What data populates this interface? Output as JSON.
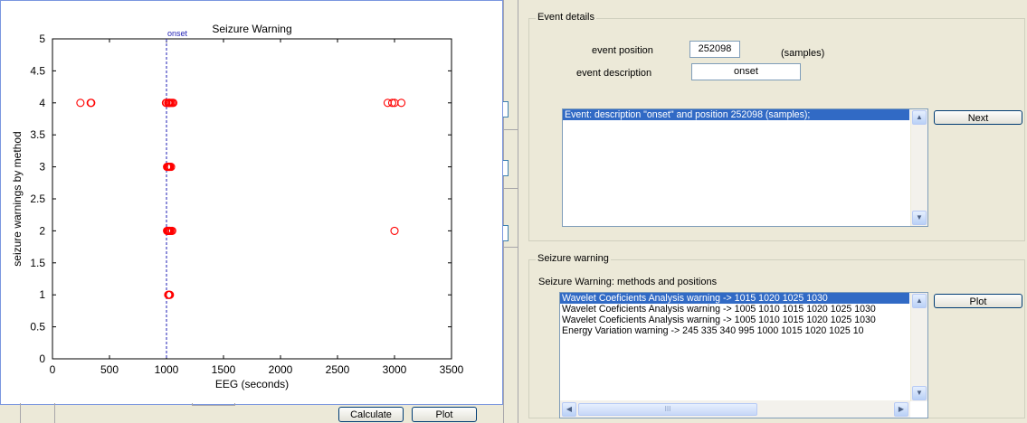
{
  "figure": {
    "chart_data": {
      "type": "scatter",
      "title": "Seizure Warning",
      "xlabel": "EEG (seconds)",
      "ylabel": "seizure warnings by method",
      "xlim": [
        0,
        3500
      ],
      "ylim": [
        0,
        5
      ],
      "xticks": [
        0,
        500,
        1000,
        1500,
        2000,
        2500,
        3000,
        3500
      ],
      "yticks": [
        0,
        0.5,
        1,
        1.5,
        2,
        2.5,
        3,
        3.5,
        4,
        4.5,
        5
      ],
      "marker": "open-circle",
      "marker_color": "#ff0000",
      "onset_line": {
        "x": 1000,
        "label": "onset",
        "color": "#1f1fb4",
        "style": "dashed"
      },
      "series": [
        {
          "values": [
            {
              "x": 1015,
              "y": 1
            },
            {
              "x": 1020,
              "y": 1
            },
            {
              "x": 1025,
              "y": 1
            },
            {
              "x": 1030,
              "y": 1
            }
          ]
        },
        {
          "values": [
            {
              "x": 1005,
              "y": 2
            },
            {
              "x": 1010,
              "y": 2
            },
            {
              "x": 1015,
              "y": 2
            },
            {
              "x": 1020,
              "y": 2
            },
            {
              "x": 1025,
              "y": 2
            },
            {
              "x": 1030,
              "y": 2
            },
            {
              "x": 1040,
              "y": 2
            },
            {
              "x": 1050,
              "y": 2
            },
            {
              "x": 3000,
              "y": 2
            }
          ]
        },
        {
          "values": [
            {
              "x": 1005,
              "y": 3
            },
            {
              "x": 1010,
              "y": 3
            },
            {
              "x": 1015,
              "y": 3
            },
            {
              "x": 1020,
              "y": 3
            },
            {
              "x": 1025,
              "y": 3
            },
            {
              "x": 1030,
              "y": 3
            },
            {
              "x": 1040,
              "y": 3
            }
          ]
        },
        {
          "values": [
            {
              "x": 245,
              "y": 4
            },
            {
              "x": 335,
              "y": 4
            },
            {
              "x": 340,
              "y": 4
            },
            {
              "x": 995,
              "y": 4
            },
            {
              "x": 1000,
              "y": 4
            },
            {
              "x": 1015,
              "y": 4
            },
            {
              "x": 1020,
              "y": 4
            },
            {
              "x": 1025,
              "y": 4
            },
            {
              "x": 1030,
              "y": 4
            },
            {
              "x": 1040,
              "y": 4
            },
            {
              "x": 1050,
              "y": 4
            },
            {
              "x": 1060,
              "y": 4
            },
            {
              "x": 2940,
              "y": 4
            },
            {
              "x": 2980,
              "y": 4
            },
            {
              "x": 3000,
              "y": 4
            },
            {
              "x": 3060,
              "y": 4
            }
          ]
        }
      ]
    }
  },
  "buttons": {
    "calculate": "Calculate",
    "plot_bottom": "Plot",
    "next": "Next",
    "plot_warning": "Plot"
  },
  "event_details": {
    "title": "Event details",
    "position_label": "event position",
    "position_value": "252098",
    "position_unit": "(samples)",
    "description_label": "event description",
    "description_value": "onset",
    "list": [
      {
        "text": "Event: description \"onset\" and position 252098 (samples);",
        "selected": true
      }
    ]
  },
  "seizure_warning": {
    "title": "Seizure warning",
    "subtitle": "Seizure Warning: methods and positions",
    "list": [
      {
        "text": "Wavelet Coeficients Analysis warning -> 1015  1020  1025  1030",
        "selected": true
      },
      {
        "text": "Wavelet Coeficients Analysis warning -> 1005  1010  1015  1020  1025  1030",
        "selected": false
      },
      {
        "text": "Wavelet Coeficients Analysis warning -> 1005  1010  1015  1020  1025  1030",
        "selected": false
      },
      {
        "text": "Energy Variation warning -> 245  335  340  995  1000  1015  1020  1025  10",
        "selected": false
      }
    ],
    "hscroll_thumb": "III"
  },
  "icons": {
    "scroll_up": "scroll-up-icon",
    "scroll_down": "scroll-down-icon",
    "scroll_left": "scroll-left-icon",
    "scroll_right": "scroll-right-icon"
  }
}
